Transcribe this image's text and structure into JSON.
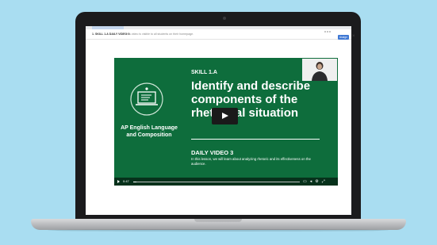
{
  "header": {
    "title": "1. SKILL 1.A DAILY VIDEO 3",
    "subtitle": "This video is visible to all students on their homepage.",
    "assign_label": "Assign",
    "close_glyph": "×"
  },
  "video": {
    "course_title": "AP English Language and Composition",
    "course_icon": "laptop-lecture-icon",
    "skill_label": "SKILL 1.A",
    "headline": "Identify and describe components of the rhetorical situation",
    "daily_label": "DAILY VIDEO 3",
    "description": "In this lesson, we will learn about analyzing rhetoric and its effectiveness on the audience.",
    "controls": {
      "time": "0:47",
      "progress": 0.02
    }
  },
  "colors": {
    "background": "#a9ddf1",
    "slide_green": "#0e6d3c",
    "laptop_bezel": "#1b1b1d",
    "accent_button": "#3f78d4"
  }
}
